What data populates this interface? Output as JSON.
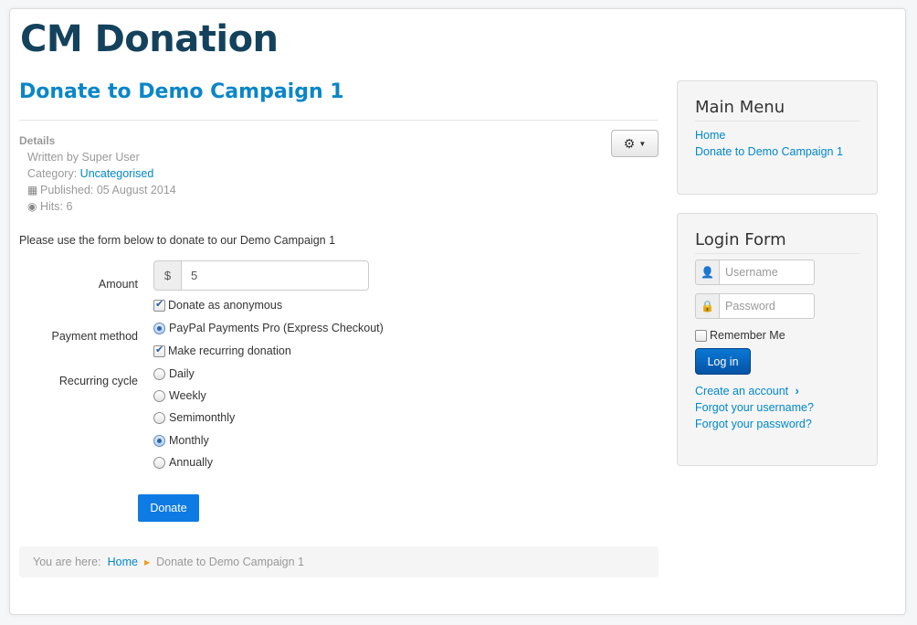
{
  "site": {
    "title": "CM Donation"
  },
  "article": {
    "title": "Donate to Demo Campaign 1",
    "details_heading": "Details",
    "written_by": "Written by Super User",
    "category_label": "Category: ",
    "category_link": "Uncategorised",
    "published": "Published: 05 August 2014",
    "hits": "Hits: 6",
    "intro": "Please use the form below to donate to our Demo Campaign 1"
  },
  "form": {
    "amount_label": "Amount",
    "currency_symbol": "$",
    "amount_value": "5",
    "anonymous_label": "Donate as anonymous",
    "anonymous_checked": true,
    "payment_method_label": "Payment method",
    "payment_option": "PayPal Payments Pro (Express Checkout)",
    "recurring_label": "Make recurring donation",
    "recurring_checked": true,
    "recurring_cycle_label": "Recurring cycle",
    "cycles": [
      "Daily",
      "Weekly",
      "Semimonthly",
      "Monthly",
      "Annually"
    ],
    "selected_cycle": "Monthly",
    "donate_button": "Donate"
  },
  "breadcrumb": {
    "prefix": "You are here:",
    "home": "Home",
    "current": "Donate to Demo Campaign 1"
  },
  "main_menu": {
    "title": "Main Menu",
    "items": [
      "Home",
      "Donate to Demo Campaign 1"
    ]
  },
  "login": {
    "title": "Login Form",
    "username_placeholder": "Username",
    "password_placeholder": "Password",
    "remember_label": "Remember Me",
    "login_button": "Log in",
    "create_account": "Create an account",
    "forgot_username": "Forgot your username?",
    "forgot_password": "Forgot your password?"
  },
  "colors": {
    "site_title": "#14425d",
    "link": "#0088cc",
    "donate_button": "#0e7ae4",
    "breadcrumb_separator": "#f19b1c"
  },
  "icons": {
    "gear": "gear-icon",
    "calendar": "calendar-icon",
    "eye": "eye-icon",
    "user": "user-icon",
    "lock": "lock-icon",
    "chevron": "chevron-right-icon"
  }
}
